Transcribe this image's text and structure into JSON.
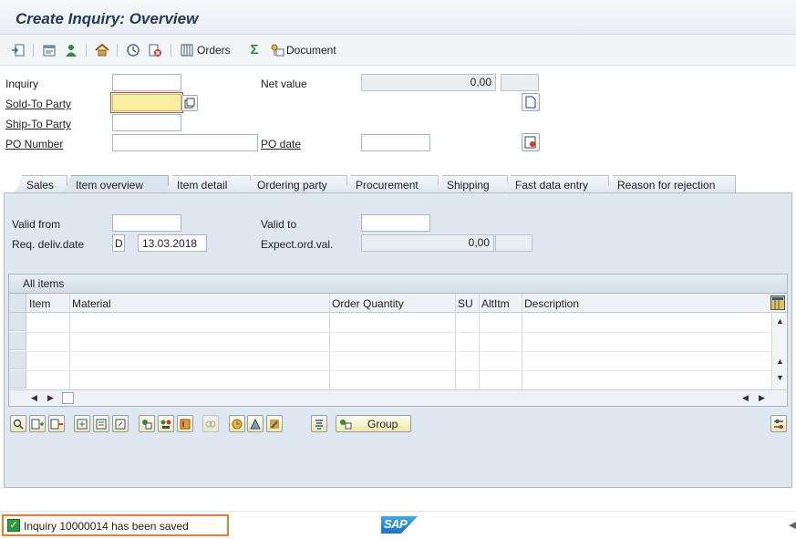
{
  "window": {
    "title": "Create Inquiry: Overview"
  },
  "toolbar": {
    "icons": [
      "display-doc-flow-icon",
      "header-details-icon",
      "business-partner-icon",
      "home-icon",
      "stock-overview-icon",
      "cancel-status-icon",
      "orders-icon",
      "sigma-icon",
      "document-icon"
    ],
    "orders_label": "Orders",
    "document_label": "Document"
  },
  "header": {
    "inquiry_label": "Inquiry",
    "inquiry_value": "",
    "net_value_label": "Net value",
    "net_value": "0,00",
    "net_value_currency": "",
    "sold_to_label": "Sold-To Party",
    "sold_to_value": "",
    "ship_to_label": "Ship-To Party",
    "ship_to_value": "",
    "po_number_label": "PO Number",
    "po_number_value": "",
    "po_date_label": "PO date",
    "po_date_value": ""
  },
  "tabs": [
    "Sales",
    "Item overview",
    "Item detail",
    "Ordering party",
    "Procurement",
    "Shipping",
    "Fast data entry",
    "Reason for rejection"
  ],
  "active_tab": "Item overview",
  "item_overview": {
    "valid_from_label": "Valid from",
    "valid_from_value": "",
    "valid_to_label": "Valid to",
    "valid_to_value": "",
    "req_deliv_label": "Req. deliv.date",
    "req_deliv_type": "D",
    "req_deliv_date": "13.03.2018",
    "expect_ord_label": "Expect.ord.val.",
    "expect_ord_value": "0,00",
    "expect_ord_currency": ""
  },
  "table": {
    "title": "All items",
    "columns": [
      "Item",
      "Material",
      "Order Quantity",
      "SU",
      "AltItm",
      "Description"
    ],
    "rows": [
      [
        "",
        "",
        "",
        "",
        "",
        ""
      ],
      [
        "",
        "",
        "",
        "",
        "",
        ""
      ],
      [
        "",
        "",
        "",
        "",
        "",
        ""
      ],
      [
        "",
        "",
        "",
        "",
        "",
        ""
      ]
    ]
  },
  "grid_buttons": {
    "group_label": "Group"
  },
  "status": {
    "message": "Inquiry 10000014 has been saved",
    "logo_text": "SAP"
  },
  "colors": {
    "status_highlight": "#ec7a2a",
    "focus_field": "#fbeea1",
    "ok_icon": "#2f9a3a"
  }
}
